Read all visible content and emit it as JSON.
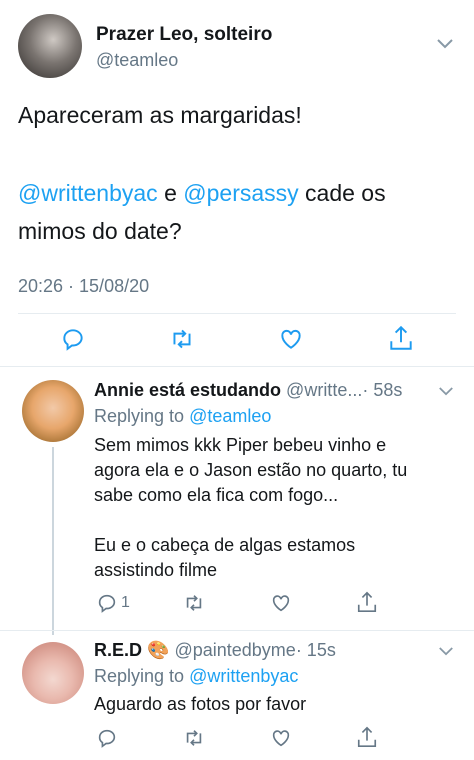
{
  "main_tweet": {
    "author_name": "Prazer Leo, solteiro",
    "handle": "@teamleo",
    "text_line1": "Apareceram as margaridas!",
    "mention1": "@writtenbyac",
    "conj": "e",
    "mention2": "@persassy",
    "text_tail": "cade os",
    "text_line3": "mimos do date?",
    "timestamp": "20:26 · 15/08/20"
  },
  "replies": [
    {
      "author_name": "Annie está estudando",
      "handle": "@writte...",
      "time": "· 58s",
      "replying_prefix": "Replying to",
      "replying_handle": "@teamleo",
      "text": [
        "Sem mimos kkk Piper bebeu vinho e",
        "agora ela e o Jason estão no quarto, tu",
        "sabe como ela fica com fogo...",
        "",
        "Eu e o cabeça de algas estamos",
        "assistindo filme"
      ],
      "reply_count": "1"
    },
    {
      "author_name": "R.E.D",
      "emoji": "🎨",
      "handle": "@paintedbyme",
      "time": "· 15s",
      "replying_prefix": "Replying to",
      "replying_handle": "@writtenbyac",
      "text": [
        "Aguardo as fotos por favor"
      ],
      "reply_count": ""
    }
  ],
  "colors": {
    "accent": "#1da1f2",
    "muted": "#657786",
    "divider": "#e6ecf0"
  },
  "icons": [
    "reply-icon",
    "retweet-icon",
    "like-icon",
    "share-icon",
    "chevron-down-icon"
  ]
}
